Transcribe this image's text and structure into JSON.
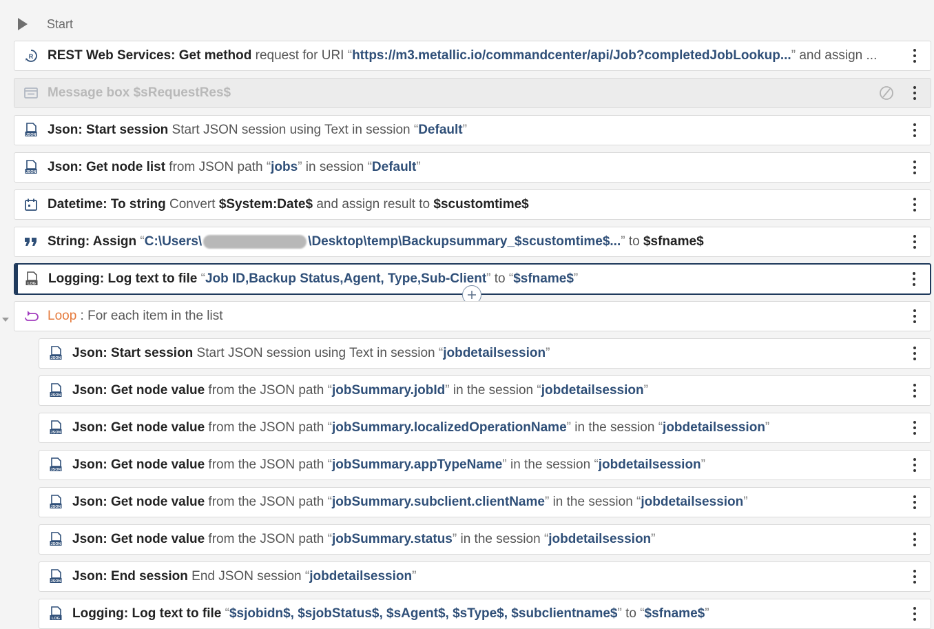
{
  "start": {
    "label": "Start"
  },
  "steps": [
    {
      "title": "REST Web Services: Get method",
      "t1": " request for URI ",
      "v1": "https://m3.metallic.io/commandcenter/api/Job?completedJobLookup...",
      "t2": " and assign ..."
    },
    {
      "title": "Message box $sRequestRes$"
    },
    {
      "title": "Json: Start session",
      "t1": " Start JSON session using Text in session ",
      "v1": "Default"
    },
    {
      "title": "Json: Get node list",
      "t1": " from JSON path ",
      "v1": "jobs",
      "t2": " in session ",
      "v2": "Default"
    },
    {
      "title": "Datetime: To string",
      "t1": " Convert ",
      "var1": "$System:Date$",
      "t2": " and assign result to ",
      "var2": "$scustomtime$"
    },
    {
      "title": "String: Assign",
      "v1a": "C:\\Users\\",
      "v1b": "\\Desktop\\temp\\Backupsummary_$scustomtime$...",
      "t2": " to ",
      "var2": "$sfname$"
    },
    {
      "title": "Logging: Log text to file",
      "v1": "Job ID,Backup Status,Agent, Type,Sub-Client",
      "t2": " to ",
      "v2": "$sfname$"
    },
    {
      "title": "Loop",
      "t1": " : For each item in the list"
    },
    {
      "title": "Json: Start session",
      "t1": " Start JSON session using Text in session ",
      "v1": "jobdetailsession"
    },
    {
      "title": "Json: Get node value",
      "t1": " from the JSON path ",
      "v1": "jobSummary.jobId",
      "t2": " in the session ",
      "v2": "jobdetailsession"
    },
    {
      "title": "Json: Get node value",
      "t1": " from the JSON path ",
      "v1": "jobSummary.localizedOperationName",
      "t2": " in the session ",
      "v2": "jobdetailsession"
    },
    {
      "title": "Json: Get node value",
      "t1": " from the JSON path ",
      "v1": "jobSummary.appTypeName",
      "t2": " in the session ",
      "v2": "jobdetailsession"
    },
    {
      "title": "Json: Get node value",
      "t1": " from the JSON path ",
      "v1": "jobSummary.subclient.clientName",
      "t2": " in the session ",
      "v2": "jobdetailsession"
    },
    {
      "title": "Json: Get node value",
      "t1": " from the JSON path ",
      "v1": "jobSummary.status",
      "t2": " in the session ",
      "v2": "jobdetailsession"
    },
    {
      "title": "Json: End session",
      "t1": " End JSON session ",
      "v1": "jobdetailsession"
    },
    {
      "title": "Logging: Log text to file",
      "v1": "$sjobidn$, $sjobStatus$, $sAgent$, $sType$, $subclientname$",
      "t2": " to ",
      "v2": "$sfname$"
    }
  ],
  "quote_open": "“",
  "quote_close": "”",
  "colors": {
    "selected_border": "#1f3a5c",
    "value_blue": "#2f4f78",
    "loop_orange": "#e57a3c"
  }
}
